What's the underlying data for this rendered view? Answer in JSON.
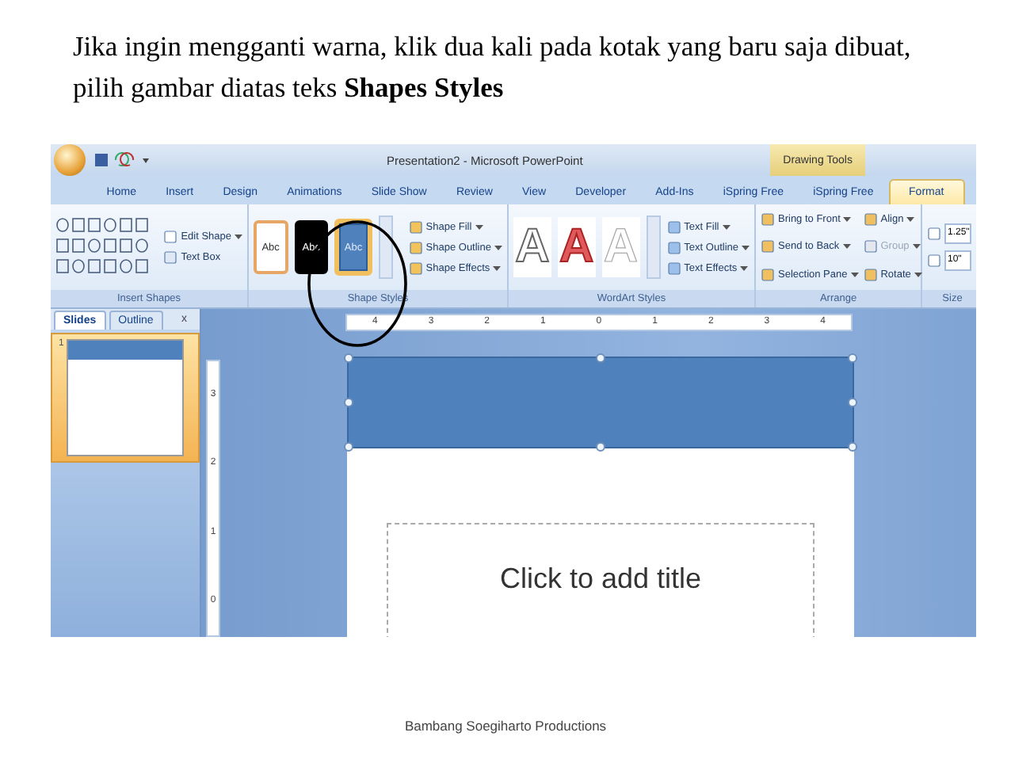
{
  "instruction": "Jika ingin mengganti warna, klik dua kali pada kotak yang baru saja dibuat, pilih gambar diatas teks **Shapes Styles**",
  "window": {
    "title": "Presentation2 - Microsoft PowerPoint",
    "contextual_label": "Drawing Tools"
  },
  "tabs": [
    {
      "label": "Home",
      "selected": false
    },
    {
      "label": "Insert",
      "selected": false
    },
    {
      "label": "Design",
      "selected": false
    },
    {
      "label": "Animations",
      "selected": false
    },
    {
      "label": "Slide Show",
      "selected": false
    },
    {
      "label": "Review",
      "selected": false
    },
    {
      "label": "View",
      "selected": false
    },
    {
      "label": "Developer",
      "selected": false
    },
    {
      "label": "Add-Ins",
      "selected": false
    },
    {
      "label": "iSpring Free",
      "selected": false
    },
    {
      "label": "iSpring Free",
      "selected": false
    },
    {
      "label": "Format",
      "selected": true
    }
  ],
  "insert_shapes": {
    "label": "Insert Shapes",
    "commands": [
      "Edit Shape",
      "Text Box"
    ]
  },
  "shape_styles": {
    "label": "Shape Styles",
    "styles": [
      {
        "label": "Abc",
        "kind": "outline",
        "selected": false
      },
      {
        "label": "Abc",
        "kind": "dark",
        "selected": false
      },
      {
        "label": "Abc",
        "kind": "filled",
        "selected": true
      }
    ],
    "commands": [
      "Shape Fill",
      "Shape Outline",
      "Shape Effects"
    ]
  },
  "wordart_styles": {
    "label": "WordArt Styles",
    "styles": [
      {
        "letter": "A",
        "kind": "outline"
      },
      {
        "letter": "A",
        "kind": "red"
      },
      {
        "letter": "A",
        "kind": "plain"
      }
    ],
    "commands": [
      "Text Fill",
      "Text Outline",
      "Text Effects"
    ]
  },
  "arrange": {
    "label": "Arrange",
    "commands": [
      {
        "label": "Bring to Front",
        "disabled": false
      },
      {
        "label": "Align",
        "disabled": false
      },
      {
        "label": "Send to Back",
        "disabled": false
      },
      {
        "label": "Group",
        "disabled": true
      },
      {
        "label": "Selection Pane",
        "disabled": false
      },
      {
        "label": "Rotate",
        "disabled": false
      }
    ]
  },
  "size": {
    "label": "Size",
    "height": "1.25\"",
    "width": "10\""
  },
  "slides_panel": {
    "tabs": [
      {
        "label": "Slides",
        "selected": true
      },
      {
        "label": "Outline",
        "selected": false
      }
    ],
    "close": "x",
    "thumbnails": [
      {
        "number": "1",
        "selected": true
      }
    ]
  },
  "horizontal_ruler": [
    "4",
    "3",
    "2",
    "1",
    "0",
    "1",
    "2",
    "3",
    "4"
  ],
  "vertical_ruler": [
    "3",
    "2",
    "1",
    "0"
  ],
  "slide": {
    "title_placeholder": "Click to add title"
  },
  "footer": "Bambang Soegiharto Productions"
}
